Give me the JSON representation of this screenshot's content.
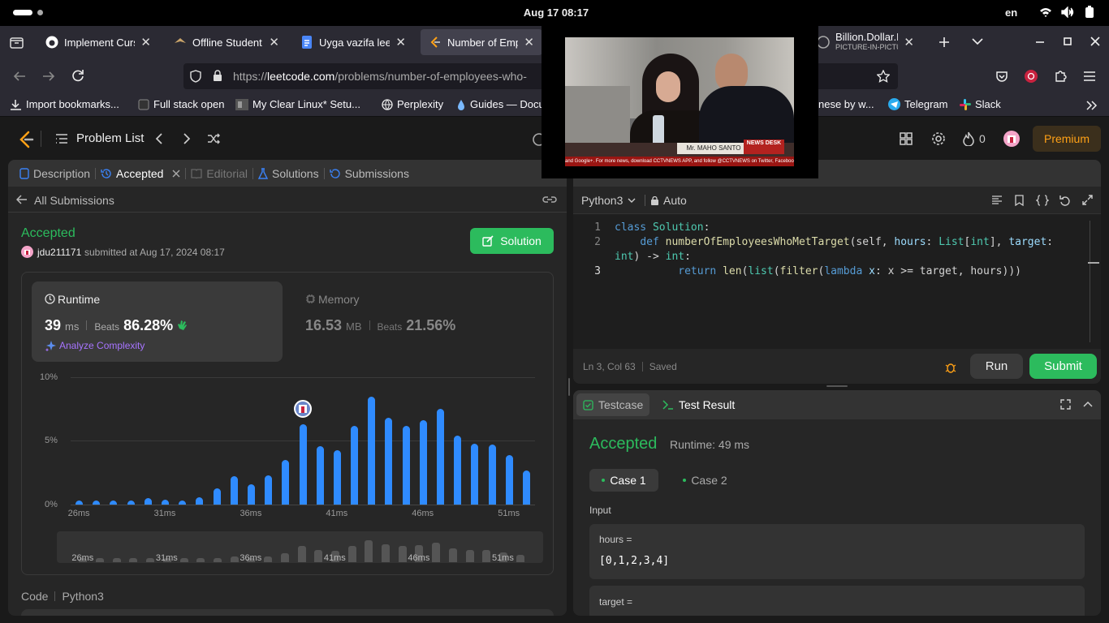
{
  "system": {
    "clock": "Aug 17  08:17",
    "lang": "en"
  },
  "tabs": [
    {
      "title": "Implement Curse",
      "close": "✕"
    },
    {
      "title": "Offline Student P",
      "close": "✕"
    },
    {
      "title": "Uyga vazifa leetc",
      "close": "✕"
    },
    {
      "title": "Number of Empl",
      "close": "✕"
    }
  ],
  "pip": {
    "title": "Billion.Dollar.Heir",
    "subtitle": "PICTURE-IN-PICTURE",
    "close": "✕",
    "news_badge": "NEWS DESK",
    "ticker": "and Google+. For more news, download CCTVNEWS APP, and follow @CCTVNEWS on Twitter, Facebook, Yo",
    "nameplate": "Mr. MAHO SANTO"
  },
  "url": {
    "prefix": "https://",
    "domain": "leetcode.com",
    "path": "/problems/number-of-employees-who-"
  },
  "bookmarks": [
    "Import bookmarks...",
    "Full stack open",
    "My Clear Linux* Setu...",
    "Perplexity",
    "Guides — Docu",
    "nese by w...",
    "Telegram",
    "Slack"
  ],
  "lc": {
    "problem_list": "Problem List",
    "streak": "0",
    "premium": "Premium"
  },
  "left": {
    "tabs": {
      "description": "Description",
      "accepted": "Accepted",
      "editorial": "Editorial",
      "solutions": "Solutions",
      "submissions": "Submissions"
    },
    "all_submissions": "All Submissions",
    "status": "Accepted",
    "user": "jdu211171",
    "submitted": "submitted at Aug 17, 2024 08:17",
    "solution_btn": "Solution",
    "runtime": {
      "label": "Runtime",
      "value": "39",
      "unit": "ms",
      "beats_label": "Beats",
      "beats": "86.28%",
      "analyze": "Analyze Complexity"
    },
    "memory": {
      "label": "Memory",
      "value": "16.53",
      "unit": "MB",
      "beats_label": "Beats",
      "beats": "21.56%"
    },
    "code_label": "Code",
    "lang": "Python3"
  },
  "chart_data": {
    "type": "bar",
    "ylabels": [
      "10%",
      "5%",
      "0%"
    ],
    "xlabels": [
      "26ms",
      "31ms",
      "36ms",
      "41ms",
      "46ms",
      "51ms"
    ],
    "ylim": [
      0,
      10
    ],
    "values": [
      0.3,
      0.3,
      0.3,
      0.3,
      0.5,
      0.4,
      0.3,
      0.6,
      1.3,
      2.2,
      1.6,
      2.3,
      3.5,
      6.3,
      4.6,
      4.3,
      6.2,
      8.5,
      6.8,
      6.2,
      6.6,
      7.5,
      5.4,
      4.8,
      4.7,
      3.9,
      2.7
    ],
    "selected_index": 13
  },
  "editor": {
    "lang": "Python3",
    "mode": "Auto",
    "lines": [
      {
        "n": "1"
      },
      {
        "n": "2"
      },
      {
        "n": "3"
      }
    ],
    "code": {
      "l1a": "class",
      "l1b": "Solution",
      ":": ":",
      "l2a": "def",
      "l2b": "numberOfEmployeesWhoMetTarget",
      "l2c": "(self, ",
      "l2d": "hours",
      "l2e": ": ",
      "l2f": "List",
      "l2g": "[",
      "l2h": "int",
      "l2i": "], ",
      "l2j": "target",
      "l2k": ": ",
      "l2l": "int",
      ") -> ": ") -> ",
      "l2m": "int",
      "l2n": ":",
      "l3a": "return",
      "l3b": "len",
      "l3c": "(",
      "l3d": "list",
      "l3e": "(",
      "l3f": "filter",
      "l3g": "(",
      "l3h": "lambda",
      "l3i": " x",
      "l3j": ": x >= target, hours)))"
    },
    "status": "Ln 3, Col 63",
    "saved": "Saved",
    "run": "Run",
    "submit": "Submit"
  },
  "result": {
    "tab_testcase": "Testcase",
    "tab_result": "Test Result",
    "status": "Accepted",
    "runtime": "Runtime: 49 ms",
    "case1": "Case 1",
    "case2": "Case 2",
    "input_label": "Input",
    "var1": "hours =",
    "val1": "[0,1,2,3,4]",
    "var2": "target ="
  },
  "colors": {
    "accent_green": "#2cbb5d",
    "brand_orange": "#ffa116",
    "bar_blue": "#2f8bff"
  }
}
